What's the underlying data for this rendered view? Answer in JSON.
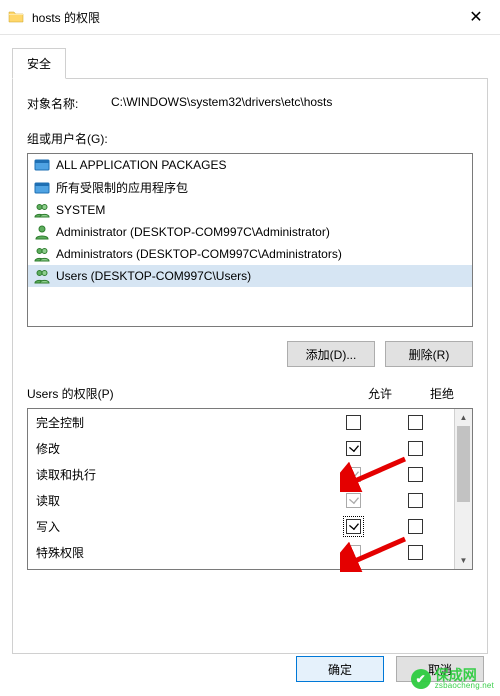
{
  "window": {
    "title": "hosts 的权限"
  },
  "tab": {
    "security": "安全"
  },
  "object": {
    "label": "对象名称:",
    "value": "C:\\WINDOWS\\system32\\drivers\\etc\\hosts"
  },
  "groups": {
    "label": "组或用户名(G):",
    "items": [
      {
        "name": "ALL APPLICATION PACKAGES",
        "icon": "packages"
      },
      {
        "name": "所有受限制的应用程序包",
        "icon": "packages"
      },
      {
        "name": "SYSTEM",
        "icon": "users"
      },
      {
        "name": "Administrator (DESKTOP-COM997C\\Administrator)",
        "icon": "user"
      },
      {
        "name": "Administrators (DESKTOP-COM997C\\Administrators)",
        "icon": "users"
      },
      {
        "name": "Users (DESKTOP-COM997C\\Users)",
        "icon": "users",
        "selected": true
      }
    ],
    "add_btn": "添加(D)...",
    "remove_btn": "删除(R)"
  },
  "permissions": {
    "title": "Users 的权限(P)",
    "col_allow": "允许",
    "col_deny": "拒绝",
    "rows": [
      {
        "name": "完全控制",
        "allow": false,
        "allow_dim": false,
        "deny": false
      },
      {
        "name": "修改",
        "allow": true,
        "allow_dim": false,
        "deny": false
      },
      {
        "name": "读取和执行",
        "allow": true,
        "allow_dim": true,
        "deny": false
      },
      {
        "name": "读取",
        "allow": true,
        "allow_dim": true,
        "deny": false
      },
      {
        "name": "写入",
        "allow": true,
        "allow_dim": false,
        "allow_focus": true,
        "deny": false
      },
      {
        "name": "特殊权限",
        "allow": false,
        "allow_dim": true,
        "deny": false
      }
    ]
  },
  "footer": {
    "ok": "确定",
    "cancel": "取消"
  },
  "watermark": {
    "cn": "保成网",
    "en": "zsbaocheng.net"
  }
}
